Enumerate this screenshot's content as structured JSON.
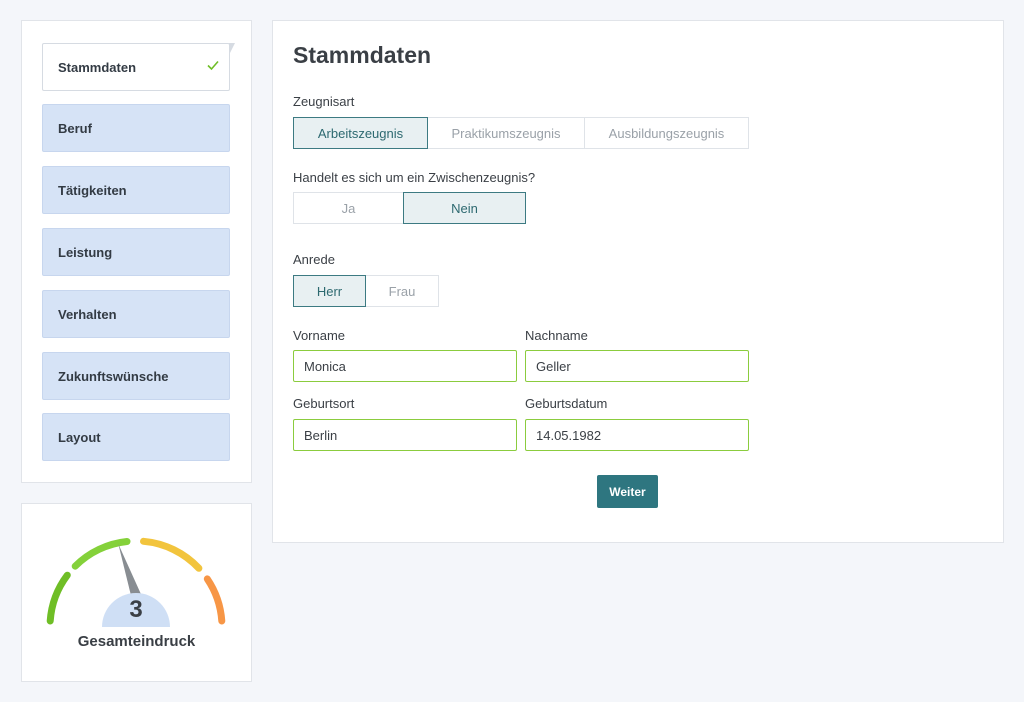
{
  "nav": {
    "items": [
      {
        "label": "Stammdaten",
        "active": true,
        "done": true
      },
      {
        "label": "Beruf"
      },
      {
        "label": "Tätigkeiten"
      },
      {
        "label": "Leistung"
      },
      {
        "label": "Verhalten"
      },
      {
        "label": "Zukunftswünsche"
      },
      {
        "label": "Layout"
      }
    ]
  },
  "gauge": {
    "value": 3,
    "min": 1,
    "max": 6,
    "label": "Gesamteindruck",
    "colors": [
      "#6fbe26",
      "#84d13a",
      "#f2c43d",
      "#f79646"
    ]
  },
  "form": {
    "title": "Stammdaten",
    "zeugnisart": {
      "label": "Zeugnisart",
      "options": [
        "Arbeitszeugnis",
        "Praktikumszeugnis",
        "Ausbildungszeugnis"
      ],
      "selected": "Arbeitszeugnis"
    },
    "zwischenzeugnis": {
      "label": "Handelt es sich um ein Zwischenzeugnis?",
      "options": [
        "Ja",
        "Nein"
      ],
      "selected": "Nein"
    },
    "anrede": {
      "label": "Anrede",
      "options": [
        "Herr",
        "Frau"
      ],
      "selected": "Herr"
    },
    "vorname": {
      "label": "Vorname",
      "value": "Monica"
    },
    "nachname": {
      "label": "Nachname",
      "value": "Geller"
    },
    "geburtsort": {
      "label": "Geburtsort",
      "value": "Berlin"
    },
    "geburtsdatum": {
      "label": "Geburtsdatum",
      "value": "14.05.1982"
    },
    "submit_label": "Weiter"
  },
  "colors": {
    "accent": "#2e7680",
    "nav_bg": "#d6e3f6",
    "valid_border": "#8bcc3e",
    "check": "#6fbe26"
  }
}
